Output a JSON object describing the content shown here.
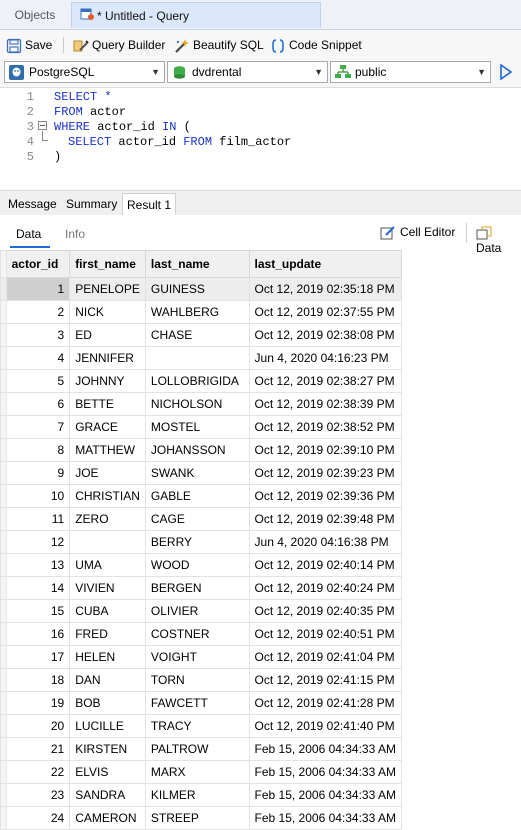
{
  "tabs": {
    "objects": "Objects",
    "query": "* Untitled - Query"
  },
  "toolbar": {
    "save": "Save",
    "query_builder": "Query Builder",
    "beautify": "Beautify SQL",
    "snippet": "Code Snippet"
  },
  "selectors": {
    "connection": "PostgreSQL",
    "database": "dvdrental",
    "schema": "public"
  },
  "editor": {
    "line_numbers": [
      "1",
      "2",
      "3",
      "4",
      "5"
    ],
    "l1_kw": "SELECT *",
    "l2_kw": "FROM",
    "l2_rest": " actor",
    "l3_kw1": "WHERE",
    "l3_rest": " actor_id ",
    "l3_kw2": "IN",
    "l3_paren": " (",
    "l4_kw1": "SELECT",
    "l4_mid": " actor_id ",
    "l4_kw2": "FROM",
    "l4_rest": " film_actor",
    "l5": ")"
  },
  "result_tabs": {
    "message": "Message",
    "summary": "Summary",
    "result": "Result 1"
  },
  "subtabs": {
    "data": "Data",
    "info": "Info",
    "cell_editor": "Cell Editor",
    "data_btn": "Data"
  },
  "grid": {
    "columns": [
      "actor_id",
      "first_name",
      "last_name",
      "last_update"
    ],
    "rows": [
      [
        "1",
        "PENELOPE",
        "GUINESS",
        "Oct 12, 2019 02:35:18 PM"
      ],
      [
        "2",
        "NICK",
        "WAHLBERG",
        "Oct 12, 2019 02:37:55 PM"
      ],
      [
        "3",
        "ED",
        "CHASE",
        "Oct 12, 2019 02:38:08 PM"
      ],
      [
        "4",
        "JENNIFER",
        "",
        "Jun 4, 2020 04:16:23 PM"
      ],
      [
        "5",
        "JOHNNY",
        "LOLLOBRIGIDA",
        "Oct 12, 2019 02:38:27 PM"
      ],
      [
        "6",
        "BETTE",
        "NICHOLSON",
        "Oct 12, 2019 02:38:39 PM"
      ],
      [
        "7",
        "GRACE",
        "MOSTEL",
        "Oct 12, 2019 02:38:52 PM"
      ],
      [
        "8",
        "MATTHEW",
        "JOHANSSON",
        "Oct 12, 2019 02:39:10 PM"
      ],
      [
        "9",
        "JOE",
        "SWANK",
        "Oct 12, 2019 02:39:23 PM"
      ],
      [
        "10",
        "CHRISTIAN",
        "GABLE",
        "Oct 12, 2019 02:39:36 PM"
      ],
      [
        "11",
        "ZERO",
        "CAGE",
        "Oct 12, 2019 02:39:48 PM"
      ],
      [
        "12",
        "",
        "BERRY",
        "Jun 4, 2020 04:16:38 PM"
      ],
      [
        "13",
        "UMA",
        "WOOD",
        "Oct 12, 2019 02:40:14 PM"
      ],
      [
        "14",
        "VIVIEN",
        "BERGEN",
        "Oct 12, 2019 02:40:24 PM"
      ],
      [
        "15",
        "CUBA",
        "OLIVIER",
        "Oct 12, 2019 02:40:35 PM"
      ],
      [
        "16",
        "FRED",
        "COSTNER",
        "Oct 12, 2019 02:40:51 PM"
      ],
      [
        "17",
        "HELEN",
        "VOIGHT",
        "Oct 12, 2019 02:41:04 PM"
      ],
      [
        "18",
        "DAN",
        "TORN",
        "Oct 12, 2019 02:41:15 PM"
      ],
      [
        "19",
        "BOB",
        "FAWCETT",
        "Oct 12, 2019 02:41:28 PM"
      ],
      [
        "20",
        "LUCILLE",
        "TRACY",
        "Oct 12, 2019 02:41:40 PM"
      ],
      [
        "21",
        "KIRSTEN",
        "PALTROW",
        "Feb 15, 2006 04:34:33 AM"
      ],
      [
        "22",
        "ELVIS",
        "MARX",
        "Feb 15, 2006 04:34:33 AM"
      ],
      [
        "23",
        "SANDRA",
        "KILMER",
        "Feb 15, 2006 04:34:33 AM"
      ],
      [
        "24",
        "CAMERON",
        "STREEP",
        "Feb 15, 2006 04:34:33 AM"
      ]
    ]
  },
  "icons": {
    "save": "save-icon",
    "query_builder": "query-builder-icon",
    "beautify": "beautify-icon",
    "snippet": "snippet-icon",
    "connection": "postgresql-icon",
    "database": "database-icon",
    "schema": "schema-icon",
    "cell_editor": "cell-editor-icon",
    "data_btn": "data-icon"
  },
  "colors": {
    "keyword": "#1a34c8",
    "accent": "#1e6ad6",
    "selected_row": "#cfcfcf"
  }
}
